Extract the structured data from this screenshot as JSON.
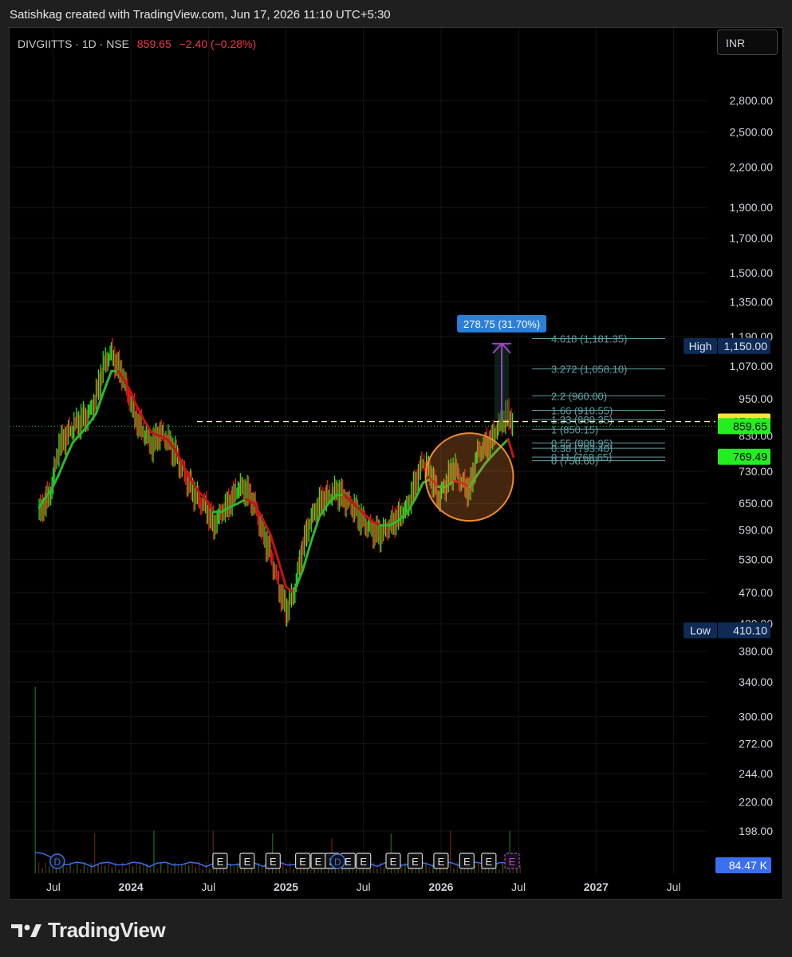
{
  "header": {
    "caption": "Satishkag created with TradingView.com, Jun 17, 2026 11:10 UTC+5:30"
  },
  "symbol": {
    "name": "DIVGIITTS · 1D · NSE",
    "price": "859.65",
    "change": "−2.40 (−0.28%)"
  },
  "currency": "INR",
  "footer": {
    "brand": "TradingView"
  },
  "colors": {
    "up": "#22ee22",
    "down": "#ff1a1a",
    "ema_up": "#2db82d",
    "ema_down": "#c41414",
    "volume_line": "#3a6ff0",
    "fib": "#5f9ea0",
    "measure": "#a040c8",
    "circle": "#f08a30"
  },
  "chart_data": {
    "type": "line",
    "scale": "log",
    "ylim": [
      180,
      3100
    ],
    "y_ticks": [
      "2,800.00",
      "2,500.00",
      "2,200.00",
      "1,900.00",
      "1,700.00",
      "1,500.00",
      "1,350.00",
      "1,190.00",
      "1,070.00",
      "950.00",
      "830.00",
      "730.00",
      "650.00",
      "590.00",
      "530.00",
      "470.00",
      "420.00",
      "380.00",
      "340.00",
      "300.00",
      "272.00",
      "244.00",
      "220.00",
      "198.00"
    ],
    "x_ticks": [
      {
        "label": "Jul",
        "t": 4.0,
        "bold": false
      },
      {
        "label": "2024",
        "t": 10.0,
        "bold": true
      },
      {
        "label": "Jul",
        "t": 16.0,
        "bold": false
      },
      {
        "label": "2025",
        "t": 22.0,
        "bold": true
      },
      {
        "label": "Jul",
        "t": 28.0,
        "bold": false
      },
      {
        "label": "2026",
        "t": 34.0,
        "bold": true
      },
      {
        "label": "Jul",
        "t": 40.0,
        "bold": false
      },
      {
        "label": "2027",
        "t": 46.0,
        "bold": true
      },
      {
        "label": "Jul",
        "t": 52.0,
        "bold": false
      }
    ],
    "x_unit": "months since Jan 2023",
    "series": [
      {
        "t": [
          2.9,
          3.3,
          3.8,
          4.4,
          5.0,
          5.5,
          6.2,
          6.8,
          7.3,
          7.7,
          8.1,
          8.5,
          9.0,
          9.3,
          9.8,
          10.4,
          11.0,
          11.6,
          12.2,
          12.8,
          13.4,
          14.0,
          14.6,
          15.2,
          15.8,
          16.4,
          17.0,
          17.6,
          18.3,
          18.9,
          19.5,
          20.1,
          20.8,
          21.4,
          22.0,
          22.6,
          23.3,
          24.0,
          24.6,
          25.3,
          25.9,
          26.5,
          27.2,
          27.9,
          28.6,
          29.3,
          30.0,
          30.7,
          31.4,
          32.0,
          32.6,
          33.2,
          33.8,
          34.4,
          35.0,
          35.6,
          36.2,
          36.8,
          37.4,
          37.9,
          38.4,
          38.8,
          39.2,
          39.6
        ],
        "close": [
          630,
          650,
          680,
          800,
          830,
          860,
          880,
          900,
          960,
          1040,
          1100,
          1120,
          1060,
          1040,
          960,
          880,
          840,
          800,
          840,
          820,
          780,
          730,
          690,
          660,
          640,
          600,
          630,
          650,
          690,
          680,
          650,
          590,
          540,
          480,
          440,
          470,
          560,
          620,
          650,
          670,
          680,
          660,
          640,
          610,
          590,
          580,
          600,
          620,
          640,
          700,
          760,
          720,
          660,
          700,
          740,
          700,
          680,
          780,
          800,
          820,
          860,
          880,
          900,
          859.65
        ]
      }
    ],
    "ema": [
      640,
      660,
      680,
      720,
      770,
      810,
      840,
      870,
      900,
      950,
      1000,
      1050,
      1050,
      1030,
      990,
      930,
      880,
      840,
      830,
      820,
      790,
      750,
      710,
      680,
      660,
      630,
      630,
      640,
      650,
      660,
      650,
      620,
      580,
      530,
      480,
      470,
      510,
      570,
      620,
      650,
      670,
      670,
      650,
      630,
      610,
      600,
      600,
      610,
      630,
      660,
      700,
      710,
      690,
      690,
      705,
      700,
      690,
      720,
      750,
      770,
      790,
      805,
      820,
      769.49
    ],
    "volume": {
      "last": "84.47 K"
    },
    "earnings_markers": [
      16.9,
      19.0,
      21.0,
      23.3,
      24.5,
      25.6,
      26.8,
      28.0,
      30.3,
      32.0,
      34.0,
      36.0,
      37.7
    ],
    "dividend_markers": [
      4.3,
      26.0
    ],
    "fib_levels": [
      {
        "ratio": "4.618",
        "value": 1181.35
      },
      {
        "ratio": "3.272",
        "value": 1058.1
      },
      {
        "ratio": "2.2",
        "value": 960.0
      },
      {
        "ratio": "1.66",
        "value": 910.55
      },
      {
        "ratio": "1.33",
        "value": 880.35
      },
      {
        "ratio": "1",
        "value": 850.15
      },
      {
        "ratio": "0.55",
        "value": 808.95
      },
      {
        "ratio": "0.38",
        "value": 793.4
      },
      {
        "ratio": "0.11",
        "value": 768.65
      },
      {
        "ratio": "0",
        "value": 758.6
      }
    ],
    "fib_label_texts": [
      "4.618 (1,181.35)",
      "3.272 (1,058.10)",
      "2.2 (960.00)",
      "1.66 (910.55)",
      "1.33 (880.35)",
      "1 (850.15)",
      "0.55 (808.95)",
      "0.38 (793.40)",
      "0.11 (768.65)",
      "0 (758.60)"
    ],
    "measure": {
      "label": "278.75 (31.70%)",
      "from": 880,
      "to": 1160,
      "t": 38.7
    },
    "dashed_line": 874.4,
    "dotted_line": 859.65,
    "badges": {
      "high": {
        "label": "High",
        "value": "1,150.00",
        "y": 1150
      },
      "low": {
        "label": "Low",
        "value": "410.10",
        "y": 410.1
      },
      "dashed": {
        "value": "874.40",
        "y": 874.4
      },
      "last": {
        "value": "859.65",
        "y": 859.65
      },
      "ema": {
        "value": "769.49",
        "y": 769.49
      }
    },
    "circle": {
      "t": 36.2,
      "y": 715
    }
  }
}
